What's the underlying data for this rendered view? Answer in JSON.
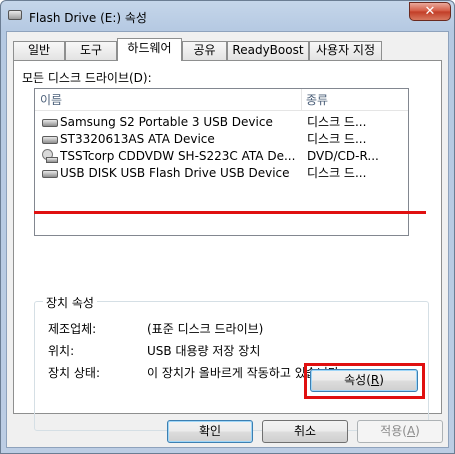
{
  "window": {
    "title": "Flash Drive (E:) 속성",
    "close_label": "✕"
  },
  "tabs": [
    {
      "label": "일반"
    },
    {
      "label": "도구"
    },
    {
      "label": "하드웨어"
    },
    {
      "label": "공유"
    },
    {
      "label": "ReadyBoost"
    },
    {
      "label": "사용자 지정"
    }
  ],
  "active_tab": "하드웨어",
  "drives": {
    "label": "모든 디스크 드라이브(D):",
    "columns": [
      "이름",
      "종류"
    ],
    "rows": [
      {
        "name": "Samsung S2 Portable 3 USB Device",
        "type": "디스크 드...",
        "icon": "drive-icon"
      },
      {
        "name": "ST3320613AS ATA Device",
        "type": "디스크 드...",
        "icon": "drive-icon"
      },
      {
        "name": "TSSTcorp CDDVDW SH-S223C ATA De...",
        "type": "DVD/CD-R...",
        "icon": "dvd-drive-icon"
      },
      {
        "name": "USB DISK USB Flash Drive USB Device",
        "type": "디스크 드...",
        "icon": "drive-icon"
      }
    ]
  },
  "device_properties": {
    "title": "장치 속성",
    "items": [
      {
        "label": "제조업체:",
        "value": "(표준 디스크 드라이브)"
      },
      {
        "label": "위치:",
        "value": "USB 대용량 저장 장치"
      },
      {
        "label": "장치 상태:",
        "value": "이 장치가 올바르게 작동하고 있습니다."
      }
    ],
    "properties_button": {
      "text": "속성",
      "accel": "R"
    }
  },
  "footer": {
    "ok": "확인",
    "cancel": "취소",
    "apply_text": "적용",
    "apply_accel": "A"
  },
  "colors": {
    "highlight": "#e01010",
    "window_frame": "#bccde4"
  }
}
